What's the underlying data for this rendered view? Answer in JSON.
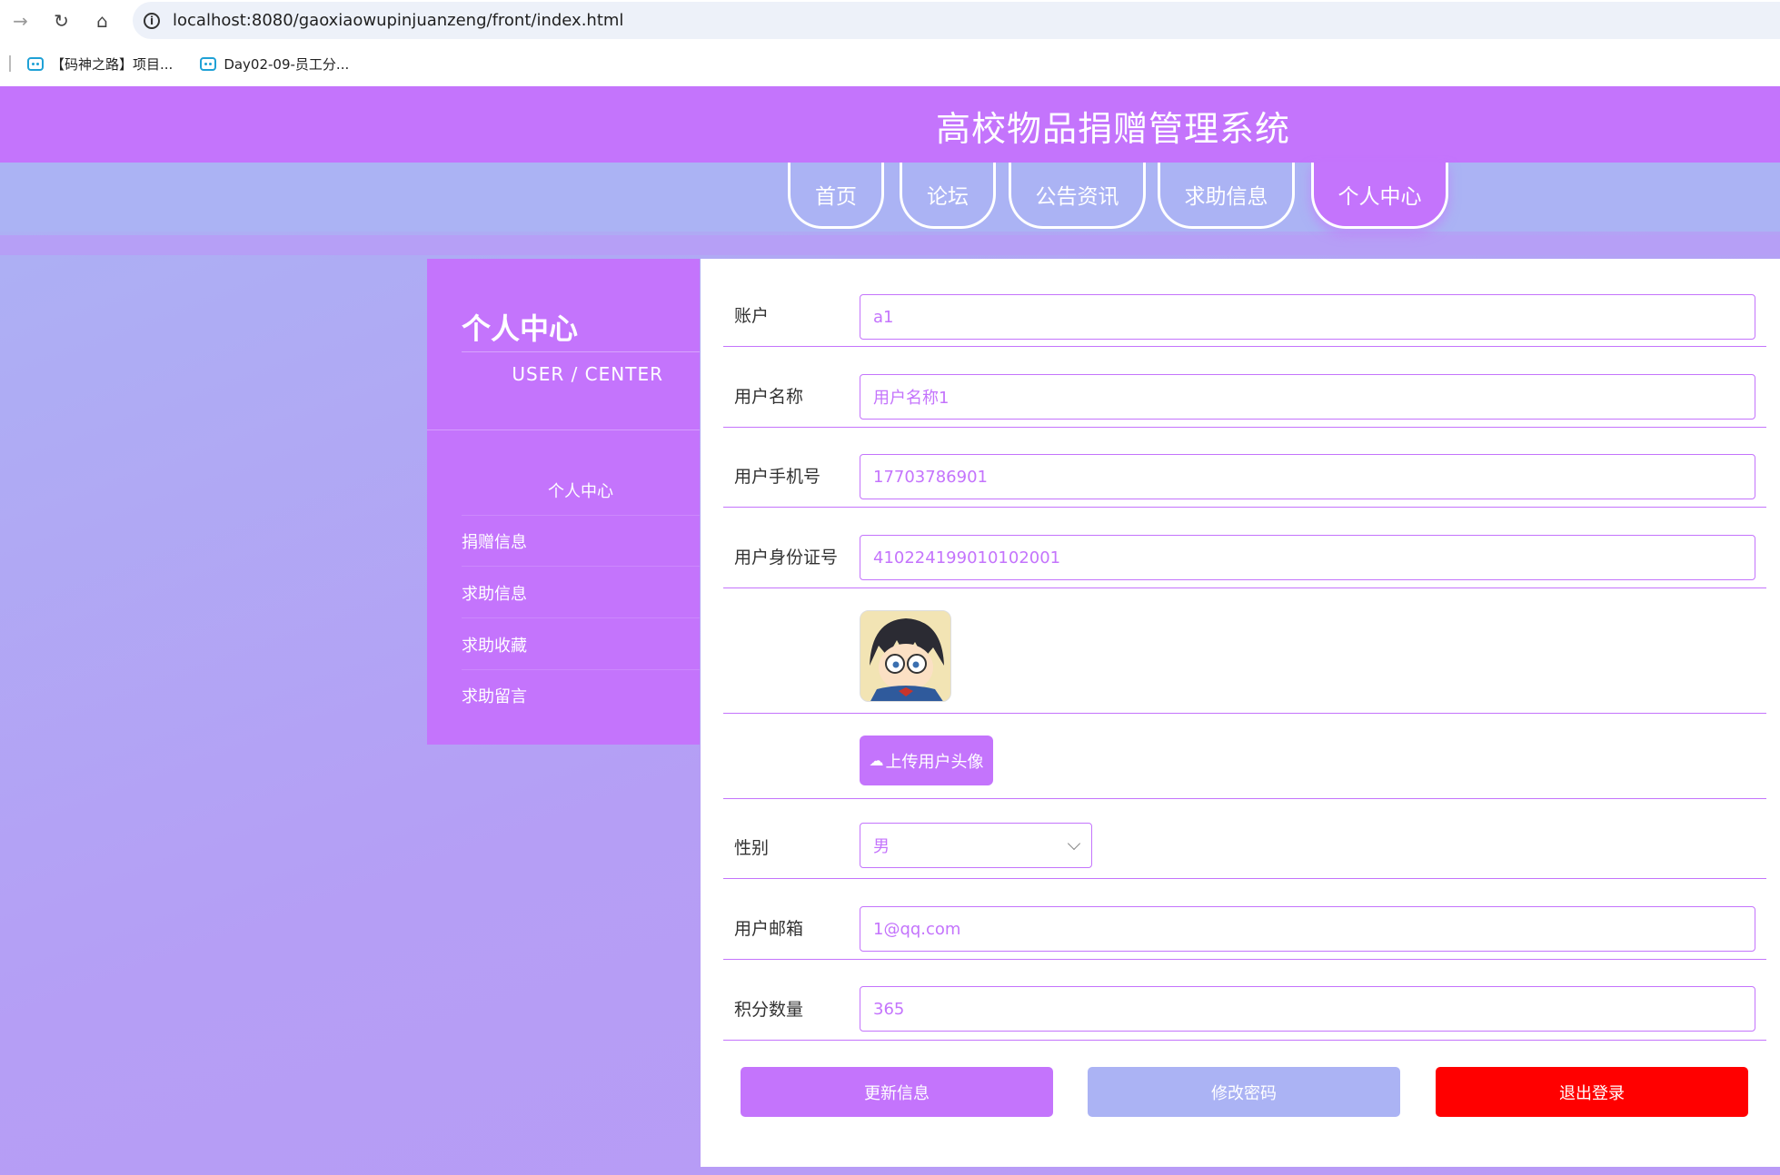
{
  "browser": {
    "url": "localhost:8080/gaoxiaowupinjuanzeng/front/index.html",
    "bookmarks": [
      "【码神之路】项目...",
      "Day02-09-员工分..."
    ]
  },
  "site": {
    "title": "高校物品捐赠管理系统",
    "nav": [
      "首页",
      "论坛",
      "公告资讯",
      "求助信息",
      "个人中心"
    ],
    "active_nav": "个人中心"
  },
  "sidebar": {
    "title": "个人中心",
    "subtitle": "USER / CENTER",
    "items": [
      "个人中心",
      "捐赠信息",
      "求助信息",
      "求助收藏",
      "求助留言"
    ]
  },
  "form": {
    "account_label": "账户",
    "account_value": "a1",
    "username_label": "用户名称",
    "username_value": "用户名称1",
    "phone_label": "用户手机号",
    "phone_value": "17703786901",
    "idcard_label": "用户身份证号",
    "idcard_value": "410224199010102001",
    "upload_label": "上传用户头像",
    "gender_label": "性别",
    "gender_value": "男",
    "email_label": "用户邮箱",
    "email_value": "1@qq.com",
    "points_label": "积分数量",
    "points_value": "365"
  },
  "actions": {
    "update": "更新信息",
    "change_password": "修改密码",
    "logout": "退出登录"
  },
  "colors": {
    "primary": "#c474fc",
    "secondary": "#abb3f4",
    "danger": "#ff0000"
  }
}
